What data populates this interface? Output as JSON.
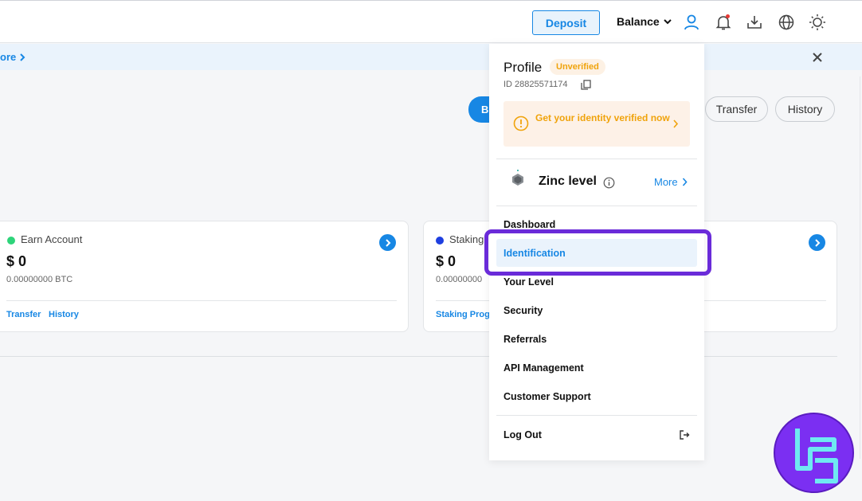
{
  "topbar": {
    "deposit_label": "Deposit",
    "balance_label": "Balance",
    "icons": [
      "user-icon",
      "bell-icon",
      "download-icon",
      "globe-icon",
      "sun-icon"
    ]
  },
  "notice": {
    "more_label": "ore"
  },
  "actions": {
    "partial_label": "B",
    "transfer_label": "Transfer",
    "history_label": "History"
  },
  "cards": [
    {
      "title": "Earn Account",
      "amount": "$ 0",
      "btc": "0.00000000 BTC",
      "dot_color": "#2ed47a",
      "links": [
        "Transfer",
        "History"
      ]
    },
    {
      "title": "Staking",
      "amount": "$ 0",
      "btc": "0.00000000",
      "dot_color": "#1e3fe0",
      "links": [
        "Staking Progr"
      ]
    }
  ],
  "dropdown": {
    "profile_title": "Profile",
    "status_badge": "Unverified",
    "id_text": "ID 28825571174",
    "verify_prompt": "Get your identity verified now",
    "level_name": "Zinc level",
    "level_more": "More",
    "menu": [
      "Dashboard",
      "Identification",
      "Your Level",
      "Security",
      "Referrals",
      "API Management",
      "Customer Support"
    ],
    "active_item": "Identification",
    "logout_label": "Log Out"
  },
  "colors": {
    "accent": "#1787e4",
    "warning": "#f0a30b",
    "highlight": "#6a2bd9"
  }
}
